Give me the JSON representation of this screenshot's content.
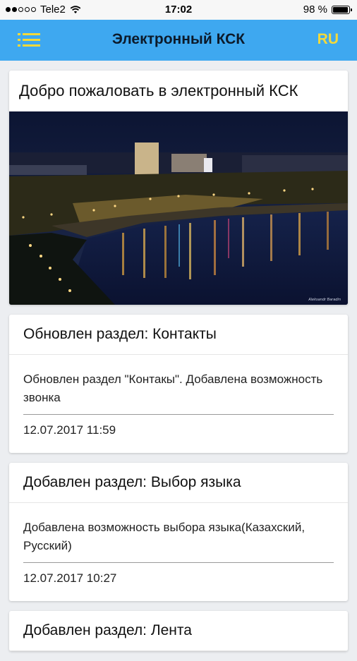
{
  "status_bar": {
    "carrier": "Tele2",
    "time": "17:02",
    "battery": "98 %",
    "battery_level": 0.98,
    "signal_bars_filled": 2,
    "signal_bars_total": 5
  },
  "app_bar": {
    "title": "Электронный КСК",
    "lang": "RU",
    "accent": "#3ea8f0",
    "icon_color": "#f4d93a"
  },
  "welcome": {
    "title": "Добро пожаловать в электронный КСК",
    "image_caption": "Aleksandr Baradin"
  },
  "posts": [
    {
      "title": "Обновлен раздел: Контакты",
      "body": "Обновлен раздел \"Контакы\". Добавлена возможность звонка",
      "date": "12.07.2017 11:59"
    },
    {
      "title": "Добавлен раздел: Выбор языка",
      "body": "Добавлена возможность выбора языка(Казахский, Русский)",
      "date": "12.07.2017 10:27"
    },
    {
      "title": "Добавлен раздел: Лента"
    }
  ]
}
